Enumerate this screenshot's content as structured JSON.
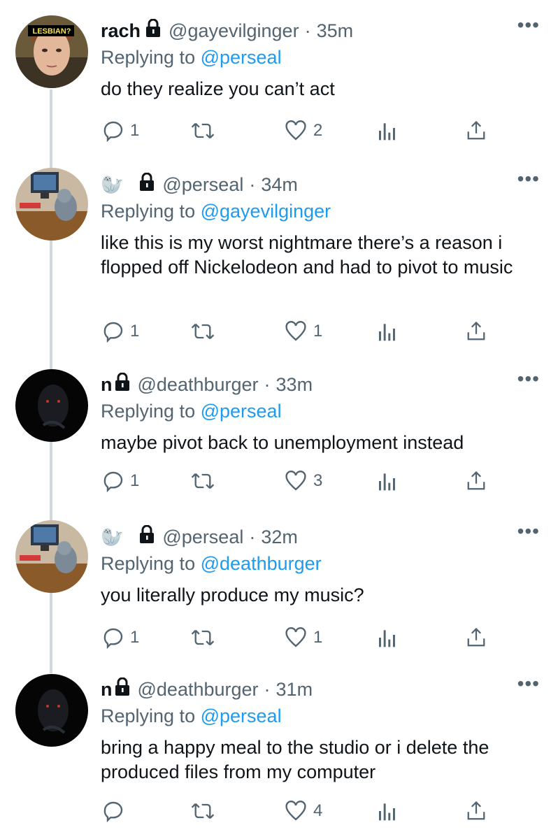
{
  "tweets": [
    {
      "name": "rach",
      "avatar_badge": "LESBIAN?",
      "handle": "@gayevilginger",
      "time": "35m",
      "replying_label": "Replying to",
      "replying_to": "@perseal",
      "text": "do they realize you can’t act",
      "replies": "1",
      "likes": "2",
      "more": "•••"
    },
    {
      "name": "🦭",
      "handle": "@perseal",
      "time": "34m",
      "replying_label": "Replying to",
      "replying_to": "@gayevilginger",
      "text": "like this is my worst nightmare there’s a reason i flopped off Nickelodeon and had to pivot to music",
      "replies": "1",
      "likes": "1",
      "more": "•••"
    },
    {
      "name": "n",
      "handle": "@deathburger",
      "time": "33m",
      "replying_label": "Replying to",
      "replying_to": "@perseal",
      "text": "maybe pivot back to unemployment instead",
      "replies": "1",
      "likes": "3",
      "more": "•••"
    },
    {
      "name": "🦭",
      "handle": "@perseal",
      "time": "32m",
      "replying_label": "Replying to",
      "replying_to": "@deathburger",
      "text": "you literally produce my music?",
      "replies": "1",
      "likes": "1",
      "more": "•••"
    },
    {
      "name": "n",
      "handle": "@deathburger",
      "time": "31m",
      "replying_label": "Replying to",
      "replying_to": "@perseal",
      "text": "bring a happy meal to the studio or i delete the produced files from my computer",
      "replies": "",
      "likes": "4",
      "more": "•••"
    }
  ],
  "separator": "·",
  "colors": {
    "link": "#1d9bf0",
    "secondary": "#536471",
    "thread_line": "#cfd9de"
  }
}
